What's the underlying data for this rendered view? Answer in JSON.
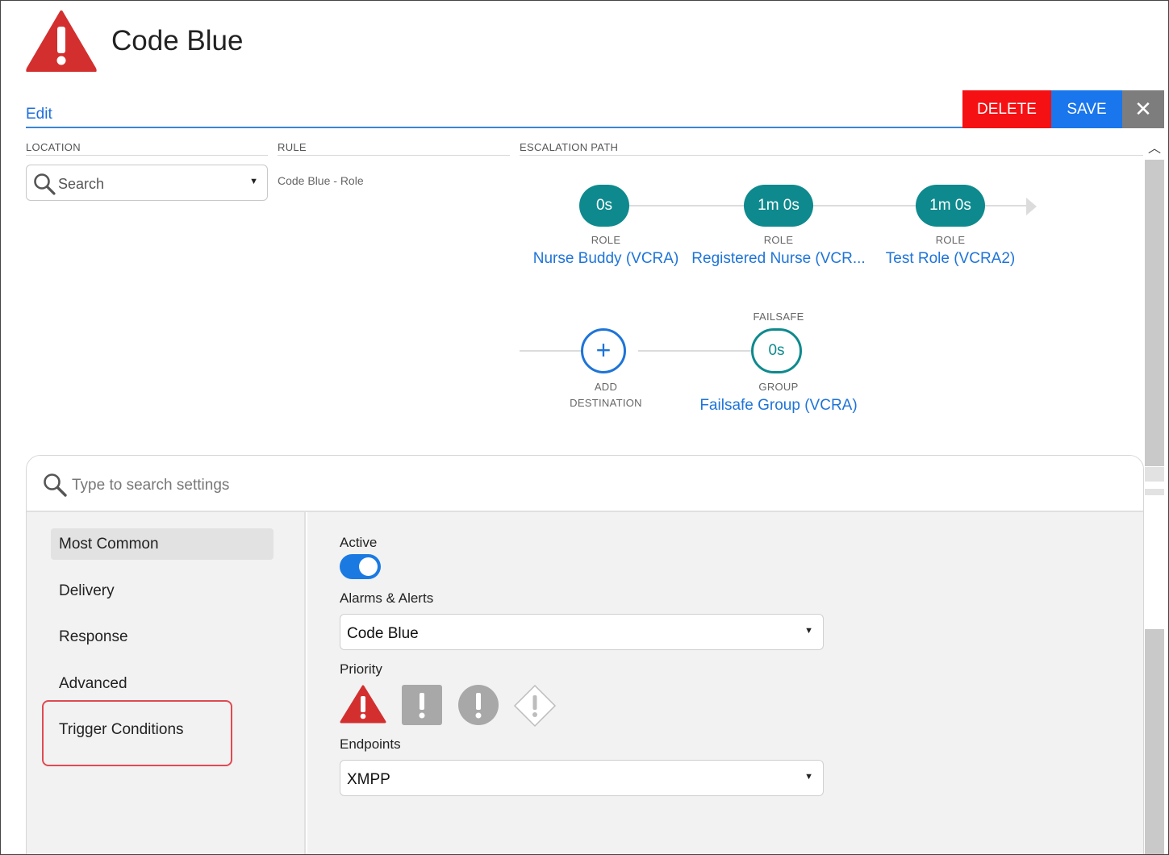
{
  "header": {
    "title": "Code Blue",
    "edit_tab": "Edit",
    "delete_label": "DELETE",
    "save_label": "SAVE",
    "close_glyph": "✕"
  },
  "columns": {
    "location": "LOCATION",
    "rule": "RULE",
    "escalation": "ESCALATION PATH"
  },
  "location": {
    "placeholder": "Search",
    "caret": "▼"
  },
  "rule": {
    "value": "Code Blue - Role"
  },
  "escalation": {
    "steps": [
      {
        "time": "0s",
        "type": "ROLE",
        "name": "Nurse Buddy (VCRA)"
      },
      {
        "time": "1m 0s",
        "type": "ROLE",
        "name": "Registered Nurse (VCR..."
      },
      {
        "time": "1m 0s",
        "type": "ROLE",
        "name": "Test Role (VCRA2)"
      }
    ],
    "add": {
      "glyph": "+",
      "line1": "ADD",
      "line2": "DESTINATION"
    },
    "failsafe": {
      "label": "FAILSAFE",
      "time": "0s",
      "type": "GROUP",
      "name": "Failsafe Group (VCRA)"
    }
  },
  "settings": {
    "search_placeholder": "Type to search settings",
    "nav": [
      "Most Common",
      "Delivery",
      "Response",
      "Advanced",
      "Trigger Conditions"
    ],
    "active_nav": "Most Common",
    "active_label": "Active",
    "active_on": true,
    "alarms_label": "Alarms & Alerts",
    "alarms_value": "Code Blue",
    "priority_label": "Priority",
    "priority_icons": [
      "priority-urgent-icon",
      "priority-high-icon",
      "priority-normal-icon",
      "priority-low-icon"
    ],
    "endpoints_label": "Endpoints",
    "endpoints_value": "XMPP",
    "caret": "▼"
  },
  "colors": {
    "delete": "#f51013",
    "save": "#1976ec",
    "close": "#7d7d7d",
    "teal": "#0e8a8e",
    "link": "#1e74d8",
    "alert_red": "#d32f2f",
    "highlight": "#e04a52"
  }
}
